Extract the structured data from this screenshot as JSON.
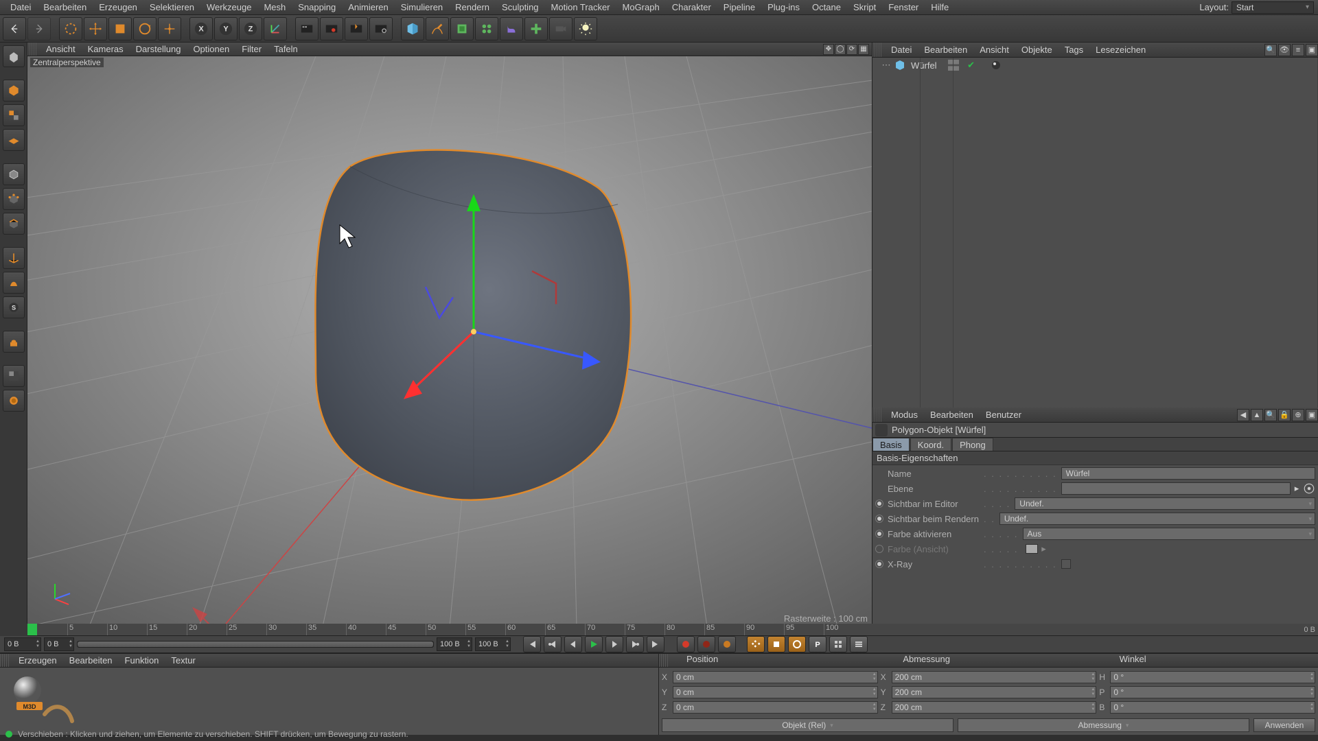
{
  "menubar": {
    "items": [
      "Datei",
      "Bearbeiten",
      "Erzeugen",
      "Selektieren",
      "Werkzeuge",
      "Mesh",
      "Snapping",
      "Animieren",
      "Simulieren",
      "Rendern",
      "Sculpting",
      "Motion Tracker",
      "MoGraph",
      "Charakter",
      "Pipeline",
      "Plug-ins",
      "Octane",
      "Skript",
      "Fenster",
      "Hilfe"
    ],
    "layout_label": "Layout:",
    "layout_value": "Start"
  },
  "viewport": {
    "menu": [
      "Ansicht",
      "Kameras",
      "Darstellung",
      "Optionen",
      "Filter",
      "Tafeln"
    ],
    "label": "Zentralperspektive",
    "grid_info": "Rasterweite : 100 cm"
  },
  "objects_panel": {
    "menu": [
      "Datei",
      "Bearbeiten",
      "Ansicht",
      "Objekte",
      "Tags",
      "Lesezeichen"
    ],
    "tree": [
      {
        "name": "Würfel",
        "icon": "polygon"
      }
    ]
  },
  "attributes_panel": {
    "menu": [
      "Modus",
      "Bearbeiten",
      "Benutzer"
    ],
    "header": "Polygon-Objekt [Würfel]",
    "tabs": [
      "Basis",
      "Koord.",
      "Phong"
    ],
    "active_tab": "Basis",
    "section_title": "Basis-Eigenschaften",
    "rows": {
      "name_label": "Name",
      "name_value": "Würfel",
      "layer_label": "Ebene",
      "layer_value": "",
      "vis_editor_label": "Sichtbar im Editor",
      "vis_editor_value": "Undef.",
      "vis_render_label": "Sichtbar beim Rendern",
      "vis_render_value": "Undef.",
      "color_enable_label": "Farbe aktivieren",
      "color_enable_value": "Aus",
      "color_view_label": "Farbe (Ansicht)",
      "xray_label": "X-Ray"
    }
  },
  "timeline": {
    "start_field": "0 B",
    "end_field_left": "0 B",
    "end_field_right": "100 B",
    "total_field": "100 B",
    "playhead_at": "0",
    "ruler_right": "0 B",
    "ticks": [
      "0",
      "5",
      "10",
      "15",
      "20",
      "25",
      "30",
      "35",
      "40",
      "45",
      "50",
      "55",
      "60",
      "65",
      "70",
      "75",
      "80",
      "85",
      "90",
      "95",
      "100"
    ]
  },
  "materials_panel": {
    "menu": [
      "Erzeugen",
      "Bearbeiten",
      "Funktion",
      "Textur"
    ]
  },
  "coords_panel": {
    "col_headers": [
      "Position",
      "Abmessung",
      "Winkel"
    ],
    "rows": [
      {
        "axis": [
          "X",
          "X",
          "H"
        ],
        "pos": "0 cm",
        "size": "200 cm",
        "ang": "0 °"
      },
      {
        "axis": [
          "Y",
          "Y",
          "P"
        ],
        "pos": "0 cm",
        "size": "200 cm",
        "ang": "0 °"
      },
      {
        "axis": [
          "Z",
          "Z",
          "B"
        ],
        "pos": "0 cm",
        "size": "200 cm",
        "ang": "0 °"
      }
    ],
    "mode_object": "Objekt (Rel)",
    "mode_size": "Abmessung",
    "apply": "Anwenden"
  },
  "statusbar": {
    "text": "Verschieben : Klicken und ziehen, um Elemente zu verschieben. SHIFT drücken, um Bewegung zu rastern."
  },
  "icons": {
    "toolbar": [
      "undo",
      "redo",
      "|",
      "live-select",
      "move",
      "scale",
      "rotate",
      "place",
      "|",
      "x-axis",
      "y-axis",
      "z-axis",
      "coord-sys",
      "|",
      "render-view",
      "render-region",
      "render-pv",
      "render-settings",
      "|",
      "add-cube",
      "spline-pen",
      "subdivision",
      "array",
      "deformer",
      "field",
      "light",
      "camera"
    ],
    "left": [
      "model-mode",
      "texture-mode",
      "|",
      "uv-poly",
      "|",
      "object-mode",
      "point-mode",
      "edge-mode",
      "poly-mode",
      "|",
      "axis-toggle",
      "workplane",
      "snap",
      "|",
      "brush",
      "|",
      "viewport-solo",
      "isoline"
    ]
  }
}
